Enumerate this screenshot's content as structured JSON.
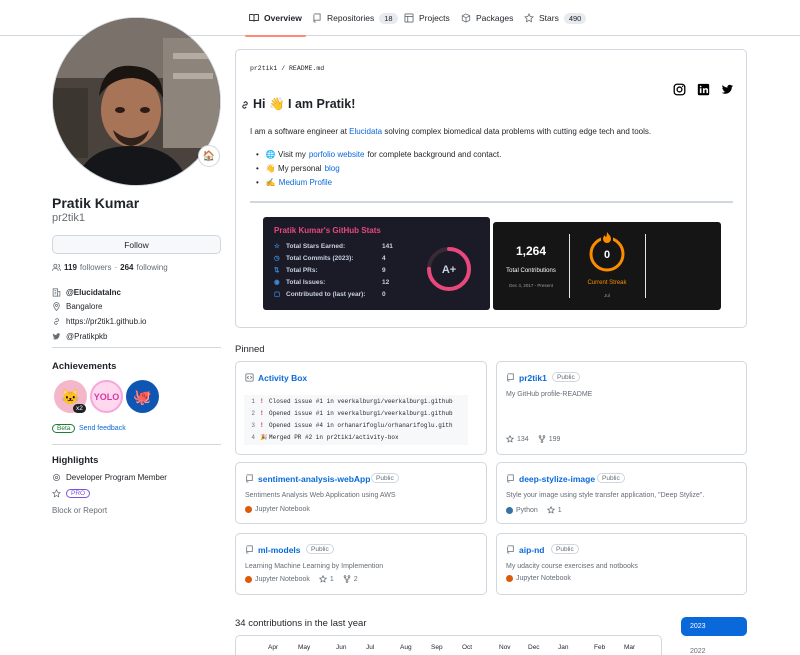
{
  "nav": {
    "tabs": [
      {
        "label": "Overview"
      },
      {
        "label": "Repositories",
        "count": "18"
      },
      {
        "label": "Projects"
      },
      {
        "label": "Packages"
      },
      {
        "label": "Stars",
        "count": "490"
      }
    ]
  },
  "profile": {
    "status_emoji": "🏠",
    "name": "Pratik Kumar",
    "login": "pr2tik1",
    "follow_label": "Follow",
    "followers_count": "119",
    "followers_label": "followers",
    "separator": "·",
    "following_count": "264",
    "following_label": "following",
    "company": "@ElucidataInc",
    "location": "Bangalore",
    "website": "https://pr2tik1.github.io",
    "twitter": "@Pratikpkb"
  },
  "achievements": {
    "title": "Achievements",
    "multiplier": "x2",
    "beta_label": "Beta",
    "feedback_label": "Send feedback"
  },
  "highlights": {
    "title": "Highlights",
    "program": "Developer Program Member",
    "pro_label": "PRO",
    "block_label": "Block or Report"
  },
  "readme": {
    "path_user": "pr2tik1",
    "path_sep": " / ",
    "path_file": "README.md",
    "heading_text": "Hi 👋 I am Pratik!",
    "intro_before": "I am a software engineer at ",
    "intro_link": "Elucidata",
    "intro_after": " solving complex biomedical data problems with cutting edge tech and tools.",
    "list": [
      {
        "prefix": "🌐 Visit my ",
        "link": "porfolio website",
        "suffix": " for complete background and contact."
      },
      {
        "prefix": "👋 My personal ",
        "link": "blog",
        "suffix": ""
      },
      {
        "prefix": "✍️ ",
        "link": "Medium Profile",
        "suffix": ""
      }
    ]
  },
  "github_stats": {
    "title": "Pratik Kumar's GitHub Stats",
    "rows": [
      {
        "icon": "☆",
        "label": "Total Stars Earned:",
        "value": "141"
      },
      {
        "icon": "◷",
        "label": "Total Commits (2023):",
        "value": "4"
      },
      {
        "icon": "⇅",
        "label": "Total PRs:",
        "value": "9"
      },
      {
        "icon": "◉",
        "label": "Total Issues:",
        "value": "12"
      },
      {
        "icon": "▢",
        "label": "Contributed to (last year):",
        "value": "0"
      }
    ],
    "grade": "A+",
    "grade_progress": 0.75,
    "accent": "#e9487d"
  },
  "streak_stats": {
    "total_value": "1,264",
    "total_label": "Total Contributions",
    "total_range": "Dec 4, 2017 - Present",
    "streak_value": "0",
    "streak_label": "Current Streak",
    "streak_sub": "Jul",
    "accent": "#fb8c00"
  },
  "pinned": {
    "title": "Pinned",
    "public_label": "Public",
    "items": [
      {
        "name": "Activity Box",
        "lines": [
          {
            "n": "1",
            "icon": "!",
            "text": "Closed issue #1 in veerkalburgi/veerkalburgi.github"
          },
          {
            "n": "2",
            "icon": "!",
            "text": "Opened issue #1 in veerkalburgi/veerkalburgi.github"
          },
          {
            "n": "3",
            "icon": "!",
            "text": "Opened issue #4 in orhanarifoglu/orhanarifoglu.gith"
          },
          {
            "n": "4",
            "icon": "🎉",
            "text": "Merged PR #2 in pr2tik1/activity-box"
          }
        ]
      },
      {
        "name": "pr2tik1",
        "desc": "My GitHub profile-README",
        "stars": "134",
        "forks": "199"
      },
      {
        "name": "sentiment-analysis-webApp",
        "desc": "Sentiments Analysis Web Application using AWS",
        "lang": "Jupyter Notebook",
        "lang_color": "#DA5B0B"
      },
      {
        "name": "deep-stylize-image",
        "desc": "Style your image using style transfer application, \"Deep Stylize\".",
        "lang": "Python",
        "lang_color": "#3572A5",
        "stars": "1"
      },
      {
        "name": "ml-models",
        "desc": "Learning Machine Learning by Implemention",
        "lang": "Jupyter Notebook",
        "lang_color": "#DA5B0B",
        "stars": "1",
        "forks": "2"
      },
      {
        "name": "aip-nd",
        "desc": "My udacity course exercises and notbooks",
        "lang": "Jupyter Notebook",
        "lang_color": "#DA5B0B"
      }
    ]
  },
  "contributions": {
    "title": "34 contributions in the last year",
    "months": [
      "Apr",
      "May",
      "Jun",
      "Jul",
      "Aug",
      "Sep",
      "Oct",
      "Nov",
      "Dec",
      "Jan",
      "Feb",
      "Mar"
    ],
    "years": [
      "2023",
      "2022"
    ],
    "active_color": "#0969da"
  }
}
